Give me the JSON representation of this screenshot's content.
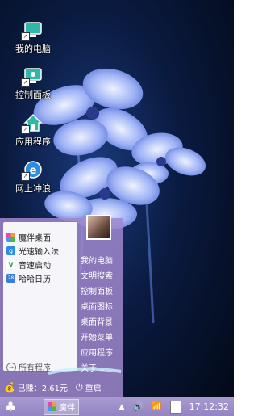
{
  "desktop": {
    "icons": [
      {
        "label": "我的电脑"
      },
      {
        "label": "控制面板"
      },
      {
        "label": "应用程序"
      },
      {
        "label": "网上冲浪"
      }
    ]
  },
  "start_menu": {
    "programs": [
      {
        "label": "魔伴桌面",
        "icon": "pinwheel-icon"
      },
      {
        "label": "光速输入法",
        "icon": "g-input-icon"
      },
      {
        "label": "音速启动",
        "icon": "v-launcher-icon"
      },
      {
        "label": "哈哈日历",
        "icon": "calendar-icon"
      }
    ],
    "all_programs_label": "所有程序",
    "system_items": [
      {
        "label": "我的电脑"
      },
      {
        "label": "文明搜索"
      },
      {
        "label": "控制面板"
      },
      {
        "label": "桌面图标"
      },
      {
        "label": "桌面背景"
      },
      {
        "label": "开始菜单"
      },
      {
        "label": "应用程序"
      },
      {
        "label": "关于..."
      }
    ],
    "earned_label": "已赚：2.61元",
    "restart_label": "重启"
  },
  "taskbar": {
    "app_label": "魔伴",
    "clock": "17:12:32"
  }
}
